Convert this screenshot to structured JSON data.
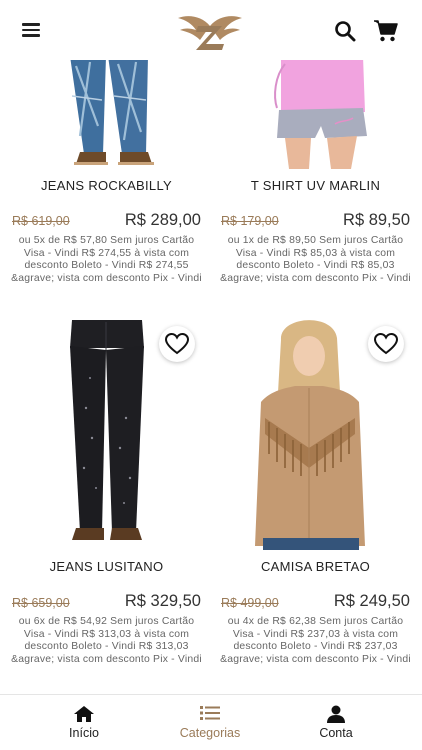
{
  "header": {
    "menu_icon": "hamburger-menu-icon",
    "logo_icon": "winged-z-logo",
    "search_icon": "search-icon",
    "cart_icon": "shopping-cart-icon"
  },
  "products": [
    {
      "name": "JEANS ROCKABILLY",
      "old_price": "R$ 619,00",
      "price": "R$ 289,00",
      "installments": "ou 5x de R$ 57,80 Sem juros Cartão Visa - Vindi R$ 274,55 à vista com desconto Boleto - Vindi R$ 274,55 &agrave; vista com desconto Pix - Vindi"
    },
    {
      "name": "T SHIRT UV MARLIN",
      "old_price": "R$ 179,00",
      "price": "R$ 89,50",
      "installments": "ou 1x de R$ 89,50 Sem juros Cartão Visa - Vindi R$ 85,03 à vista com desconto Boleto - Vindi R$ 85,03 &agrave; vista com desconto Pix - Vindi"
    },
    {
      "name": "JEANS LUSITANO",
      "old_price": "R$ 659,00",
      "price": "R$ 329,50",
      "installments": "ou 6x de R$ 54,92 Sem juros Cartão Visa - Vindi R$ 313,03 à vista com desconto Boleto - Vindi R$ 313,03 &agrave; vista com desconto Pix - Vindi"
    },
    {
      "name": "CAMISA BRETAO",
      "old_price": "R$ 499,00",
      "price": "R$ 249,50",
      "installments": "ou 4x de R$ 62,38 Sem juros Cartão Visa - Vindi R$ 237,03 à vista com desconto Boleto - Vindi R$ 237,03 &agrave; vista com desconto Pix - Vindi"
    }
  ],
  "favorite_icon": "heart-outline-icon",
  "bottom_nav": {
    "items": [
      {
        "label": "Início",
        "icon": "home-icon"
      },
      {
        "label": "Categorias",
        "icon": "list-icon",
        "active": true
      },
      {
        "label": "Conta",
        "icon": "user-icon"
      }
    ]
  },
  "colors": {
    "accent": "#9a7b59",
    "text": "#222222",
    "muted": "#666666"
  }
}
